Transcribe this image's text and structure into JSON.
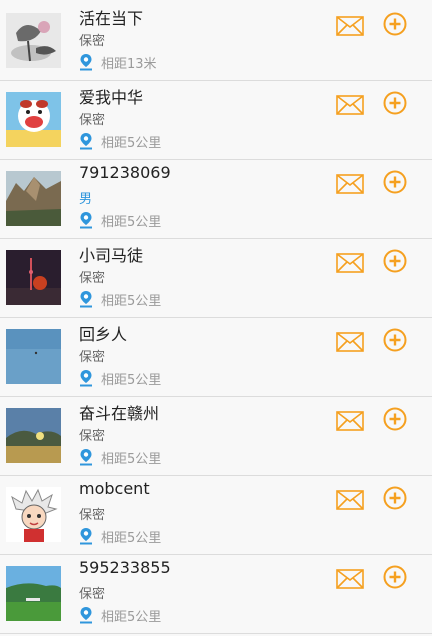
{
  "users": [
    {
      "name": "活在当下",
      "gender": "保密",
      "distance": "相距13米"
    },
    {
      "name": "爱我中华",
      "gender": "保密",
      "distance": "相距5公里"
    },
    {
      "name": "791238069",
      "gender": "男",
      "distance": "相距5公里"
    },
    {
      "name": "小司马徒",
      "gender": "保密",
      "distance": "相距5公里"
    },
    {
      "name": "回乡人",
      "gender": "保密",
      "distance": "相距5公里"
    },
    {
      "name": "奋斗在赣州",
      "gender": "保密",
      "distance": "相距5公里"
    },
    {
      "name": "mobcent",
      "gender": "保密",
      "distance": "相距5公里"
    },
    {
      "name": "595233855",
      "gender": "保密",
      "distance": "相距5公里"
    }
  ],
  "colors": {
    "accent": "#f5a020",
    "pin": "#2f96dc",
    "male": "#2f96dc"
  },
  "icons": {
    "message": "envelope-icon",
    "follow": "plus-circle-icon",
    "location": "location-pin-icon"
  }
}
